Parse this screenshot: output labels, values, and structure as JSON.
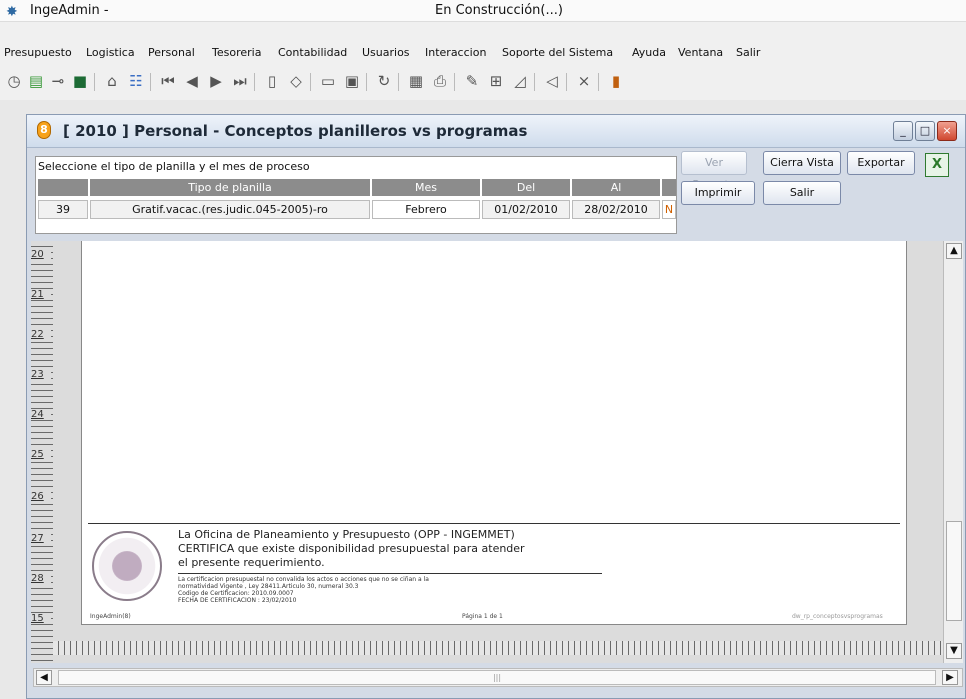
{
  "app": {
    "title_left": "IngeAdmin -",
    "title_center": "En Construcción(...)"
  },
  "menu": [
    "Presupuesto",
    "Logistica",
    "Personal",
    "Tesoreria",
    "Contabilidad",
    "Usuarios",
    "Interaccion",
    "Soporte del Sistema",
    "Ayuda",
    "Ventana",
    "Salir"
  ],
  "child": {
    "title": "[ 2010 ] Personal - Conceptos planilleros vs programas",
    "prompt": "Seleccione el tipo de planilla y el mes de proceso",
    "headers": {
      "tipo": "Tipo de planilla",
      "mes": "Mes",
      "del": "Del",
      "al": "Al"
    },
    "row": {
      "code": "39",
      "tipo": "Gratif.vacac.(res.judic.045-2005)-ro",
      "mes": "Febrero",
      "del": "01/02/2010",
      "al": "28/02/2010",
      "extra": "N"
    },
    "buttons": {
      "ver_reporte": "Ver Reporte",
      "cierra_vista": "Cierra Vista",
      "exportar": "Exportar",
      "imprimir": "Imprimir",
      "salir": "Salir"
    }
  },
  "report": {
    "ruler_numbers": [
      "20",
      "21",
      "22",
      "23",
      "24",
      "25",
      "26",
      "27",
      "28",
      "15"
    ],
    "cert_lines": [
      "La Oficina de Planeamiento y Presupuesto (OPP - INGEMMET)",
      "CERTIFICA que existe disponibilidad presupuestal para atender",
      "el presente requerimiento."
    ],
    "small_lines": [
      "La certificacion presupuestal no convalida los actos o acciones que no se ciñan a la",
      "normatividad Vigente , Ley 28411.Articulo 30, numeral 30.3",
      "Codigo de Certificacion: 2010.09.0007",
      "FECHA DE CERTIFICACION : 23/02/2010"
    ],
    "footer_left": "IngeAdmin(8)",
    "footer_center": "Página 1 de 1",
    "footer_right": "dw_rp_conceptosvsprogramas"
  },
  "colors": {
    "excel": "#2b7a2b",
    "window_icon": "#f7a21b",
    "close": "#d04830"
  }
}
